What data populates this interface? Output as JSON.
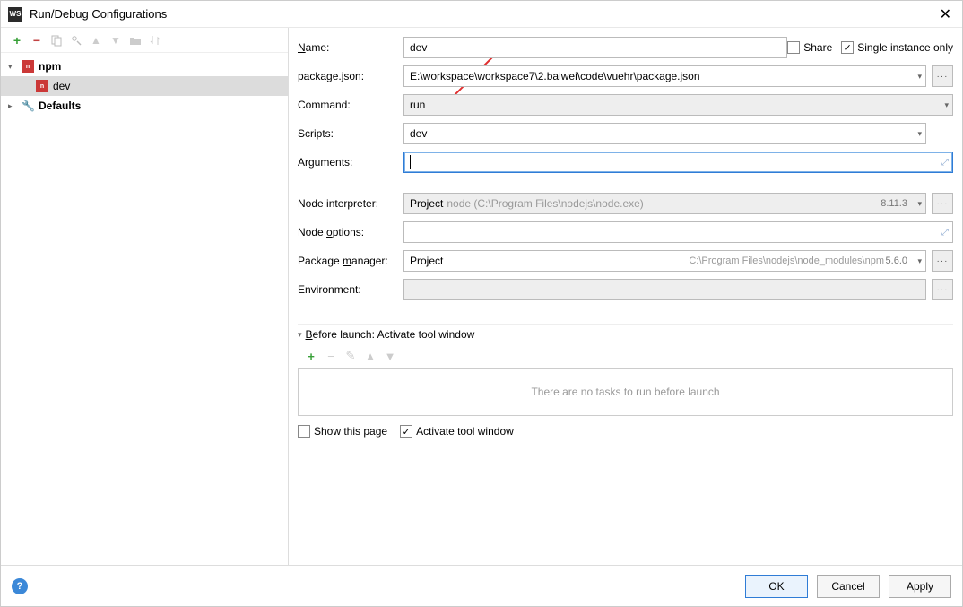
{
  "titlebar": {
    "badge": "WS",
    "title": "Run/Debug Configurations",
    "close": "✕"
  },
  "tree": {
    "npm_label": "npm",
    "dev_label": "dev",
    "defaults_label": "Defaults"
  },
  "form": {
    "name_label": "Name:",
    "name_value": "dev",
    "share_label": "Share",
    "single_instance_label": "Single instance only",
    "package_label": "package.json:",
    "package_value": "E:\\workspace\\workspace7\\2.baiwei\\code\\vuehr\\package.json",
    "command_label": "Command:",
    "command_value": "run",
    "scripts_label": "Scripts:",
    "scripts_value": "dev",
    "arguments_label": "Arguments:",
    "arguments_value": "",
    "node_interp_label": "Node interpreter:",
    "node_interp_prefix": "Project",
    "node_interp_path": "node (C:\\Program Files\\nodejs\\node.exe)",
    "node_interp_ver": "8.11.3",
    "node_options_label": "Node options:",
    "node_options_value": "",
    "pkg_mgr_label": "Package manager:",
    "pkg_mgr_prefix": "Project",
    "pkg_mgr_path": "C:\\Program Files\\nodejs\\node_modules\\npm",
    "pkg_mgr_ver": "5.6.0",
    "env_label": "Environment:",
    "env_value": ""
  },
  "before_launch": {
    "header": "Before launch: Activate tool window",
    "empty_text": "There are no tasks to run before launch",
    "show_page_label": "Show this page",
    "activate_label": "Activate tool window"
  },
  "footer": {
    "ok": "OK",
    "cancel": "Cancel",
    "apply": "Apply"
  }
}
